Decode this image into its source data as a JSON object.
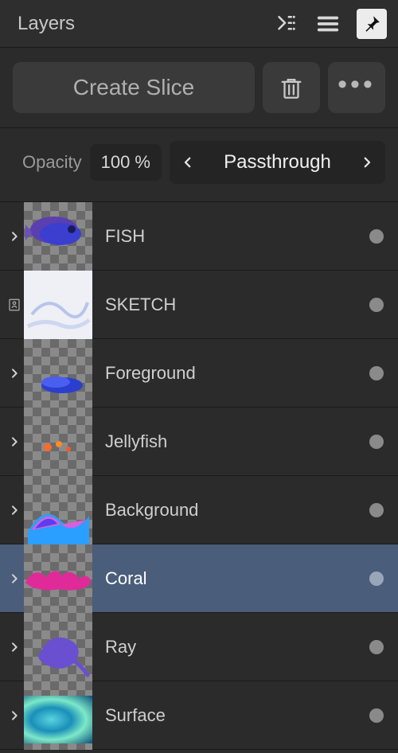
{
  "panel": {
    "title": "Layers"
  },
  "toolbar": {
    "create_slice": "Create Slice"
  },
  "options": {
    "opacity_label": "Opacity",
    "opacity_value": "100 %",
    "blend_mode": "Passthrough"
  },
  "layers": {
    "items": [
      {
        "label": "FISH",
        "expandable": true,
        "reference": false,
        "selected": false
      },
      {
        "label": "SKETCH",
        "expandable": false,
        "reference": true,
        "selected": false
      },
      {
        "label": "Foreground",
        "expandable": true,
        "reference": false,
        "selected": false
      },
      {
        "label": "Jellyfish",
        "expandable": true,
        "reference": false,
        "selected": false
      },
      {
        "label": "Background",
        "expandable": true,
        "reference": false,
        "selected": false
      },
      {
        "label": "Coral",
        "expandable": true,
        "reference": false,
        "selected": true
      },
      {
        "label": "Ray",
        "expandable": true,
        "reference": false,
        "selected": false
      },
      {
        "label": "Surface",
        "expandable": true,
        "reference": false,
        "selected": false
      }
    ]
  }
}
